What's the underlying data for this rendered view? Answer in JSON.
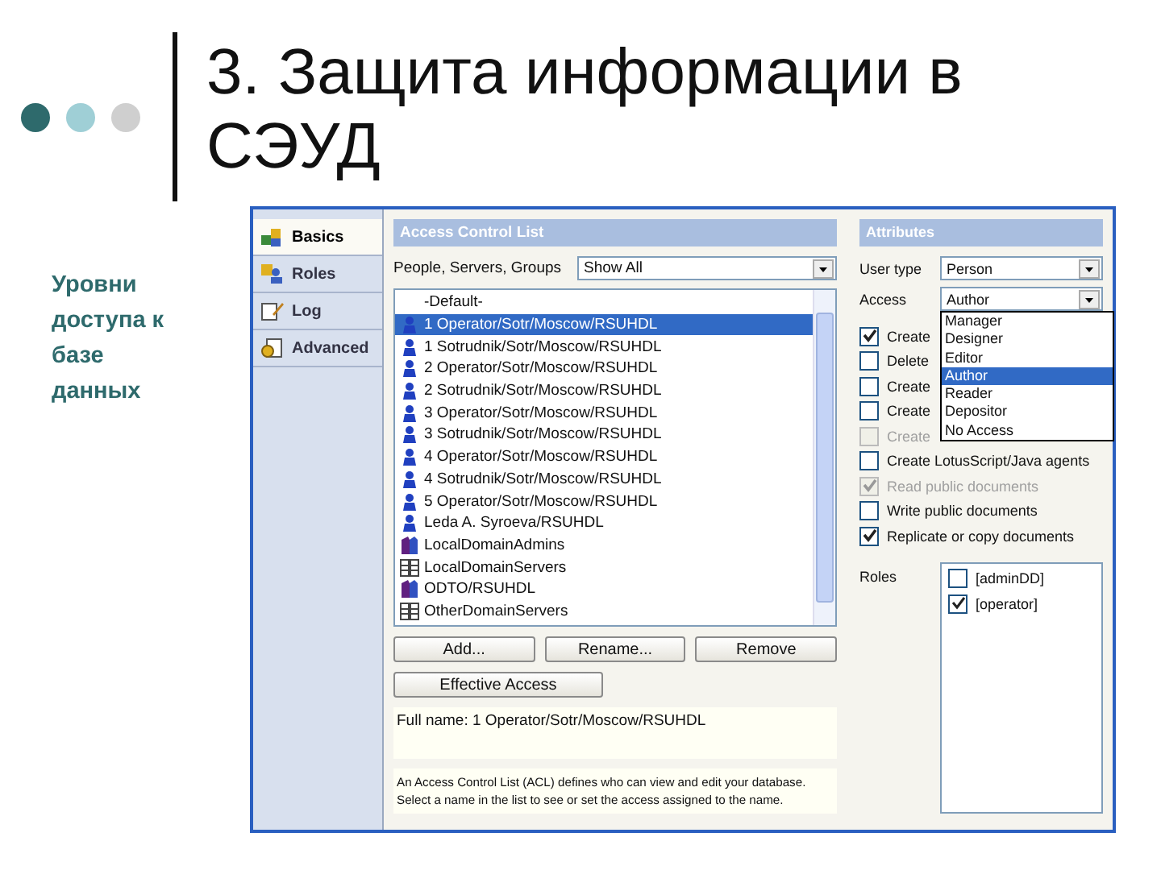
{
  "slide": {
    "title": "3. Защита информации в СЭУД",
    "side_text": "Уровни доступа к базе данных"
  },
  "tabs": [
    {
      "label": "Basics",
      "selected": true
    },
    {
      "label": "Roles",
      "selected": false
    },
    {
      "label": "Log",
      "selected": false
    },
    {
      "label": "Advanced",
      "selected": false
    }
  ],
  "acl": {
    "header": "Access Control List",
    "filter_label": "People, Servers, Groups",
    "filter_value": "Show All",
    "entries": [
      {
        "name": "-Default-",
        "kind": "default",
        "selected": false
      },
      {
        "name": "1 Operator/Sotr/Moscow/RSUHDL",
        "kind": "person",
        "selected": true
      },
      {
        "name": "1 Sotrudnik/Sotr/Moscow/RSUHDL",
        "kind": "person",
        "selected": false
      },
      {
        "name": "2 Operator/Sotr/Moscow/RSUHDL",
        "kind": "person",
        "selected": false
      },
      {
        "name": "2 Sotrudnik/Sotr/Moscow/RSUHDL",
        "kind": "person",
        "selected": false
      },
      {
        "name": "3 Operator/Sotr/Moscow/RSUHDL",
        "kind": "person",
        "selected": false
      },
      {
        "name": "3 Sotrudnik/Sotr/Moscow/RSUHDL",
        "kind": "person",
        "selected": false
      },
      {
        "name": "4 Operator/Sotr/Moscow/RSUHDL",
        "kind": "person",
        "selected": false
      },
      {
        "name": "4 Sotrudnik/Sotr/Moscow/RSUHDL",
        "kind": "person",
        "selected": false
      },
      {
        "name": "5 Operator/Sotr/Moscow/RSUHDL",
        "kind": "person",
        "selected": false
      },
      {
        "name": "Leda A. Syroeva/RSUHDL",
        "kind": "person",
        "selected": false
      },
      {
        "name": "LocalDomainAdmins",
        "kind": "group",
        "selected": false
      },
      {
        "name": "LocalDomainServers",
        "kind": "server",
        "selected": false
      },
      {
        "name": "ODTO/RSUHDL",
        "kind": "group",
        "selected": false
      },
      {
        "name": "OtherDomainServers",
        "kind": "server",
        "selected": false
      }
    ],
    "buttons": [
      "Add...",
      "Rename...",
      "Remove"
    ],
    "effective_access_button": "Effective Access",
    "full_name": "Full name: 1 Operator/Sotr/Moscow/RSUHDL",
    "description": "An Access Control List (ACL) defines who can view and edit your database.\nSelect a name in the list to see or set the access assigned to the name."
  },
  "attributes": {
    "header": "Attributes",
    "user_type_label": "User type",
    "user_type": "Person",
    "access_label": "Access",
    "access": "Author",
    "access_options": [
      {
        "label": "Manager",
        "selected": false
      },
      {
        "label": "Designer",
        "selected": false
      },
      {
        "label": "Editor",
        "selected": false
      },
      {
        "label": "Author",
        "selected": true
      },
      {
        "label": "Reader",
        "selected": false
      },
      {
        "label": "Depositor",
        "selected": false
      },
      {
        "label": "No Access",
        "selected": false
      }
    ],
    "options": [
      {
        "label": "Create",
        "checked": true,
        "disabled": false
      },
      {
        "label": "Delete",
        "checked": false,
        "disabled": false
      },
      {
        "label": "Create",
        "checked": false,
        "disabled": false
      },
      {
        "label": "Create",
        "checked": false,
        "disabled": false
      },
      {
        "label": "Create",
        "checked": false,
        "disabled": true
      },
      {
        "label": "Create LotusScript/Java agents",
        "checked": false,
        "disabled": false
      },
      {
        "label": "Read public documents",
        "checked": true,
        "disabled": true
      },
      {
        "label": "Write public documents",
        "checked": false,
        "disabled": false
      },
      {
        "label": "Replicate or copy documents",
        "checked": true,
        "disabled": false
      }
    ],
    "roles_label": "Roles",
    "roles": [
      {
        "label": "[adminDD]",
        "checked": false
      },
      {
        "label": "[operator]",
        "checked": true
      }
    ]
  }
}
